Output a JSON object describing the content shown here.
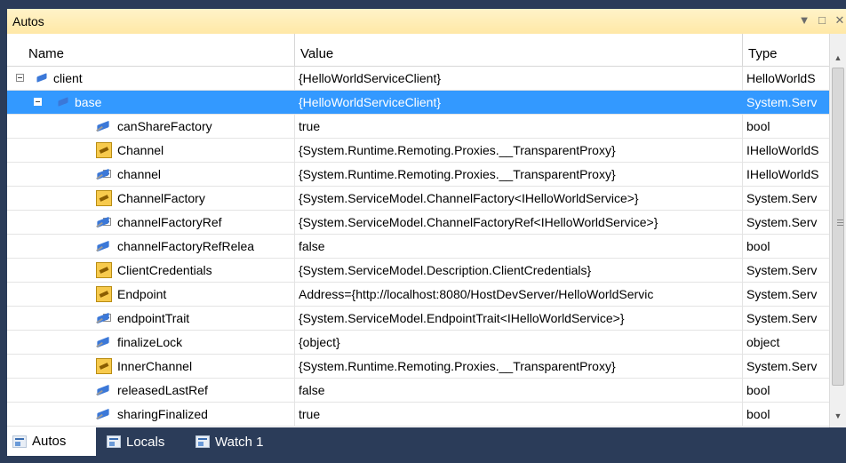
{
  "window": {
    "title": "Autos",
    "dropdown_icon": "▼",
    "maximize_icon": "□",
    "close_icon": "✕"
  },
  "columns": {
    "name": "Name",
    "value": "Value",
    "type": "Type"
  },
  "rows": [
    {
      "name": "client",
      "value": "{HelloWorldServiceClient}",
      "type": "HelloWorldS",
      "expander": "minus",
      "icon": "field-small",
      "indent": 0,
      "selected": false
    },
    {
      "name": "base",
      "value": "{HelloWorldServiceClient}",
      "type": "System.Serv",
      "expander": "minus",
      "icon": "field-small",
      "indent": 1,
      "selected": true
    },
    {
      "name": "canShareFactory",
      "value": "true",
      "type": "bool",
      "expander": "",
      "icon": "field",
      "indent": 2,
      "selected": false
    },
    {
      "name": "Channel",
      "value": "{System.Runtime.Remoting.Proxies.__TransparentProxy}",
      "type": "IHelloWorldS",
      "expander": "plus",
      "icon": "property",
      "indent": 2,
      "selected": false
    },
    {
      "name": "channel",
      "value": "{System.Runtime.Remoting.Proxies.__TransparentProxy}",
      "type": "IHelloWorldS",
      "expander": "plus",
      "icon": "field",
      "indent": 2,
      "selected": false
    },
    {
      "name": "ChannelFactory",
      "value": "{System.ServiceModel.ChannelFactory<IHelloWorldService>}",
      "type": "System.Serv",
      "expander": "plus",
      "icon": "property",
      "indent": 2,
      "selected": false
    },
    {
      "name": "channelFactoryRef",
      "value": "{System.ServiceModel.ChannelFactoryRef<IHelloWorldService>}",
      "type": "System.Serv",
      "expander": "plus",
      "icon": "field",
      "indent": 2,
      "selected": false
    },
    {
      "name": "channelFactoryRefRelea",
      "value": "false",
      "type": "bool",
      "expander": "",
      "icon": "field",
      "indent": 2,
      "selected": false
    },
    {
      "name": "ClientCredentials",
      "value": "{System.ServiceModel.Description.ClientCredentials}",
      "type": "System.Serv",
      "expander": "plus",
      "icon": "property",
      "indent": 2,
      "selected": false
    },
    {
      "name": "Endpoint",
      "value": "Address={http://localhost:8080/HostDevServer/HelloWorldServic",
      "type": "System.Serv",
      "expander": "plus",
      "icon": "property",
      "indent": 2,
      "selected": false
    },
    {
      "name": "endpointTrait",
      "value": "{System.ServiceModel.EndpointTrait<IHelloWorldService>}",
      "type": "System.Serv",
      "expander": "plus",
      "icon": "field",
      "indent": 2,
      "selected": false
    },
    {
      "name": "finalizeLock",
      "value": "{object}",
      "type": "object",
      "expander": "",
      "icon": "field",
      "indent": 2,
      "selected": false
    },
    {
      "name": "InnerChannel",
      "value": "{System.Runtime.Remoting.Proxies.__TransparentProxy}",
      "type": "System.Serv",
      "expander": "plus",
      "icon": "property",
      "indent": 2,
      "selected": false
    },
    {
      "name": "releasedLastRef",
      "value": "false",
      "type": "bool",
      "expander": "",
      "icon": "field",
      "indent": 2,
      "selected": false
    },
    {
      "name": "sharingFinalized",
      "value": "true",
      "type": "bool",
      "expander": "",
      "icon": "field",
      "indent": 2,
      "selected": false
    }
  ],
  "tabs": [
    {
      "label": "Autos",
      "active": true
    },
    {
      "label": "Locals",
      "active": false
    },
    {
      "label": "Watch 1",
      "active": false
    }
  ],
  "scrollbar": {
    "up_icon": "▲",
    "down_icon": "▼"
  }
}
